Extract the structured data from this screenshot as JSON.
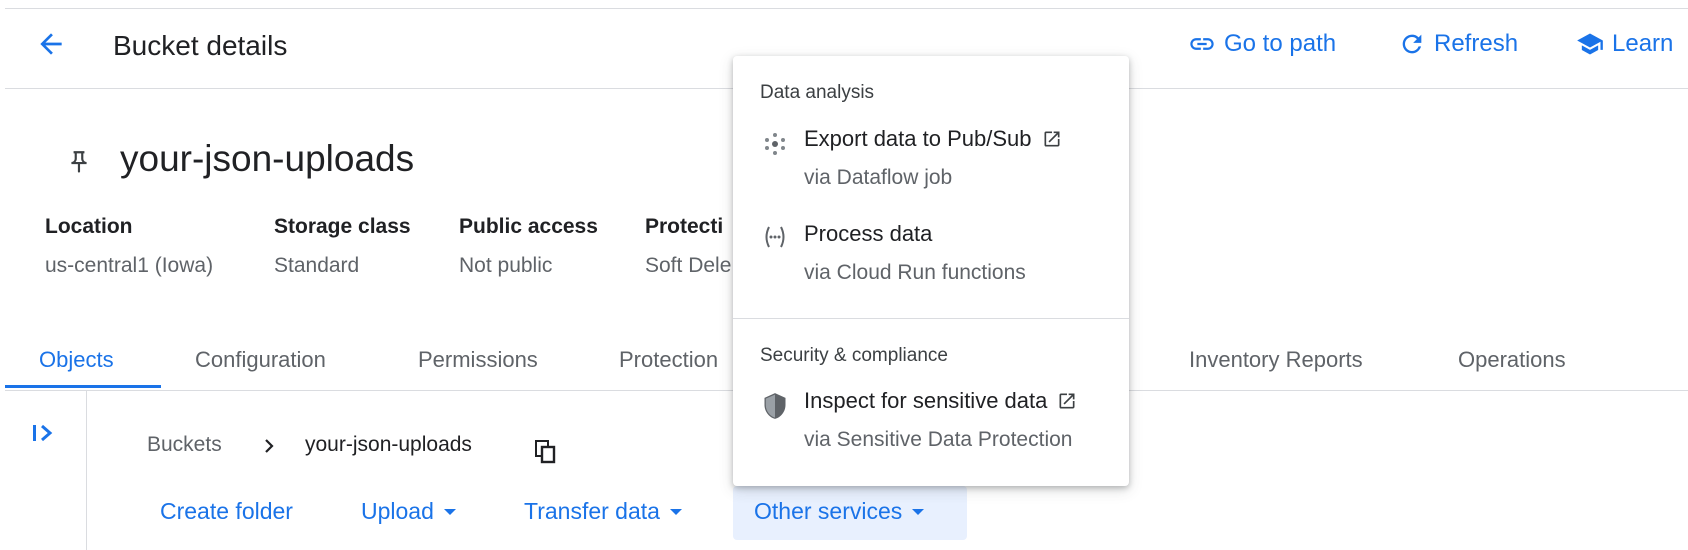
{
  "header": {
    "title": "Bucket details",
    "actions": [
      {
        "label": "Go to path",
        "icon": "link-icon"
      },
      {
        "label": "Refresh",
        "icon": "refresh-icon"
      },
      {
        "label": "Learn",
        "icon": "school-icon"
      }
    ]
  },
  "bucket": {
    "name": "your-json-uploads",
    "info": [
      {
        "label": "Location",
        "value": "us-central1 (Iowa)"
      },
      {
        "label": "Storage class",
        "value": "Standard"
      },
      {
        "label": "Public access",
        "value": "Not public"
      },
      {
        "label": "Protecti",
        "value": "Soft Dele"
      }
    ]
  },
  "tabs": [
    "Objects",
    "Configuration",
    "Permissions",
    "Protection",
    "Inventory Reports",
    "Operations"
  ],
  "active_tab": "Objects",
  "breadcrumb": {
    "root": "Buckets",
    "current": "your-json-uploads"
  },
  "toolbar": {
    "create_folder": "Create folder",
    "upload": "Upload",
    "transfer_data": "Transfer data",
    "other_services": "Other services"
  },
  "menu": {
    "sections": [
      {
        "title": "Data analysis",
        "items": [
          {
            "label": "Export data to Pub/Sub",
            "sub": "via Dataflow job",
            "icon": "pubsub-icon",
            "external": true
          },
          {
            "label": "Process data",
            "sub": "via Cloud Run functions",
            "icon": "functions-icon",
            "external": false
          }
        ]
      },
      {
        "title": "Security & compliance",
        "items": [
          {
            "label": "Inspect for sensitive data",
            "sub": "via Sensitive Data Protection",
            "icon": "shield-icon",
            "external": true
          }
        ]
      }
    ]
  },
  "colors": {
    "accent": "#1a73e8",
    "text": "#202124",
    "secondary": "#5f6368",
    "divider": "#dadce0",
    "selected_bg": "#e8f0fe"
  }
}
